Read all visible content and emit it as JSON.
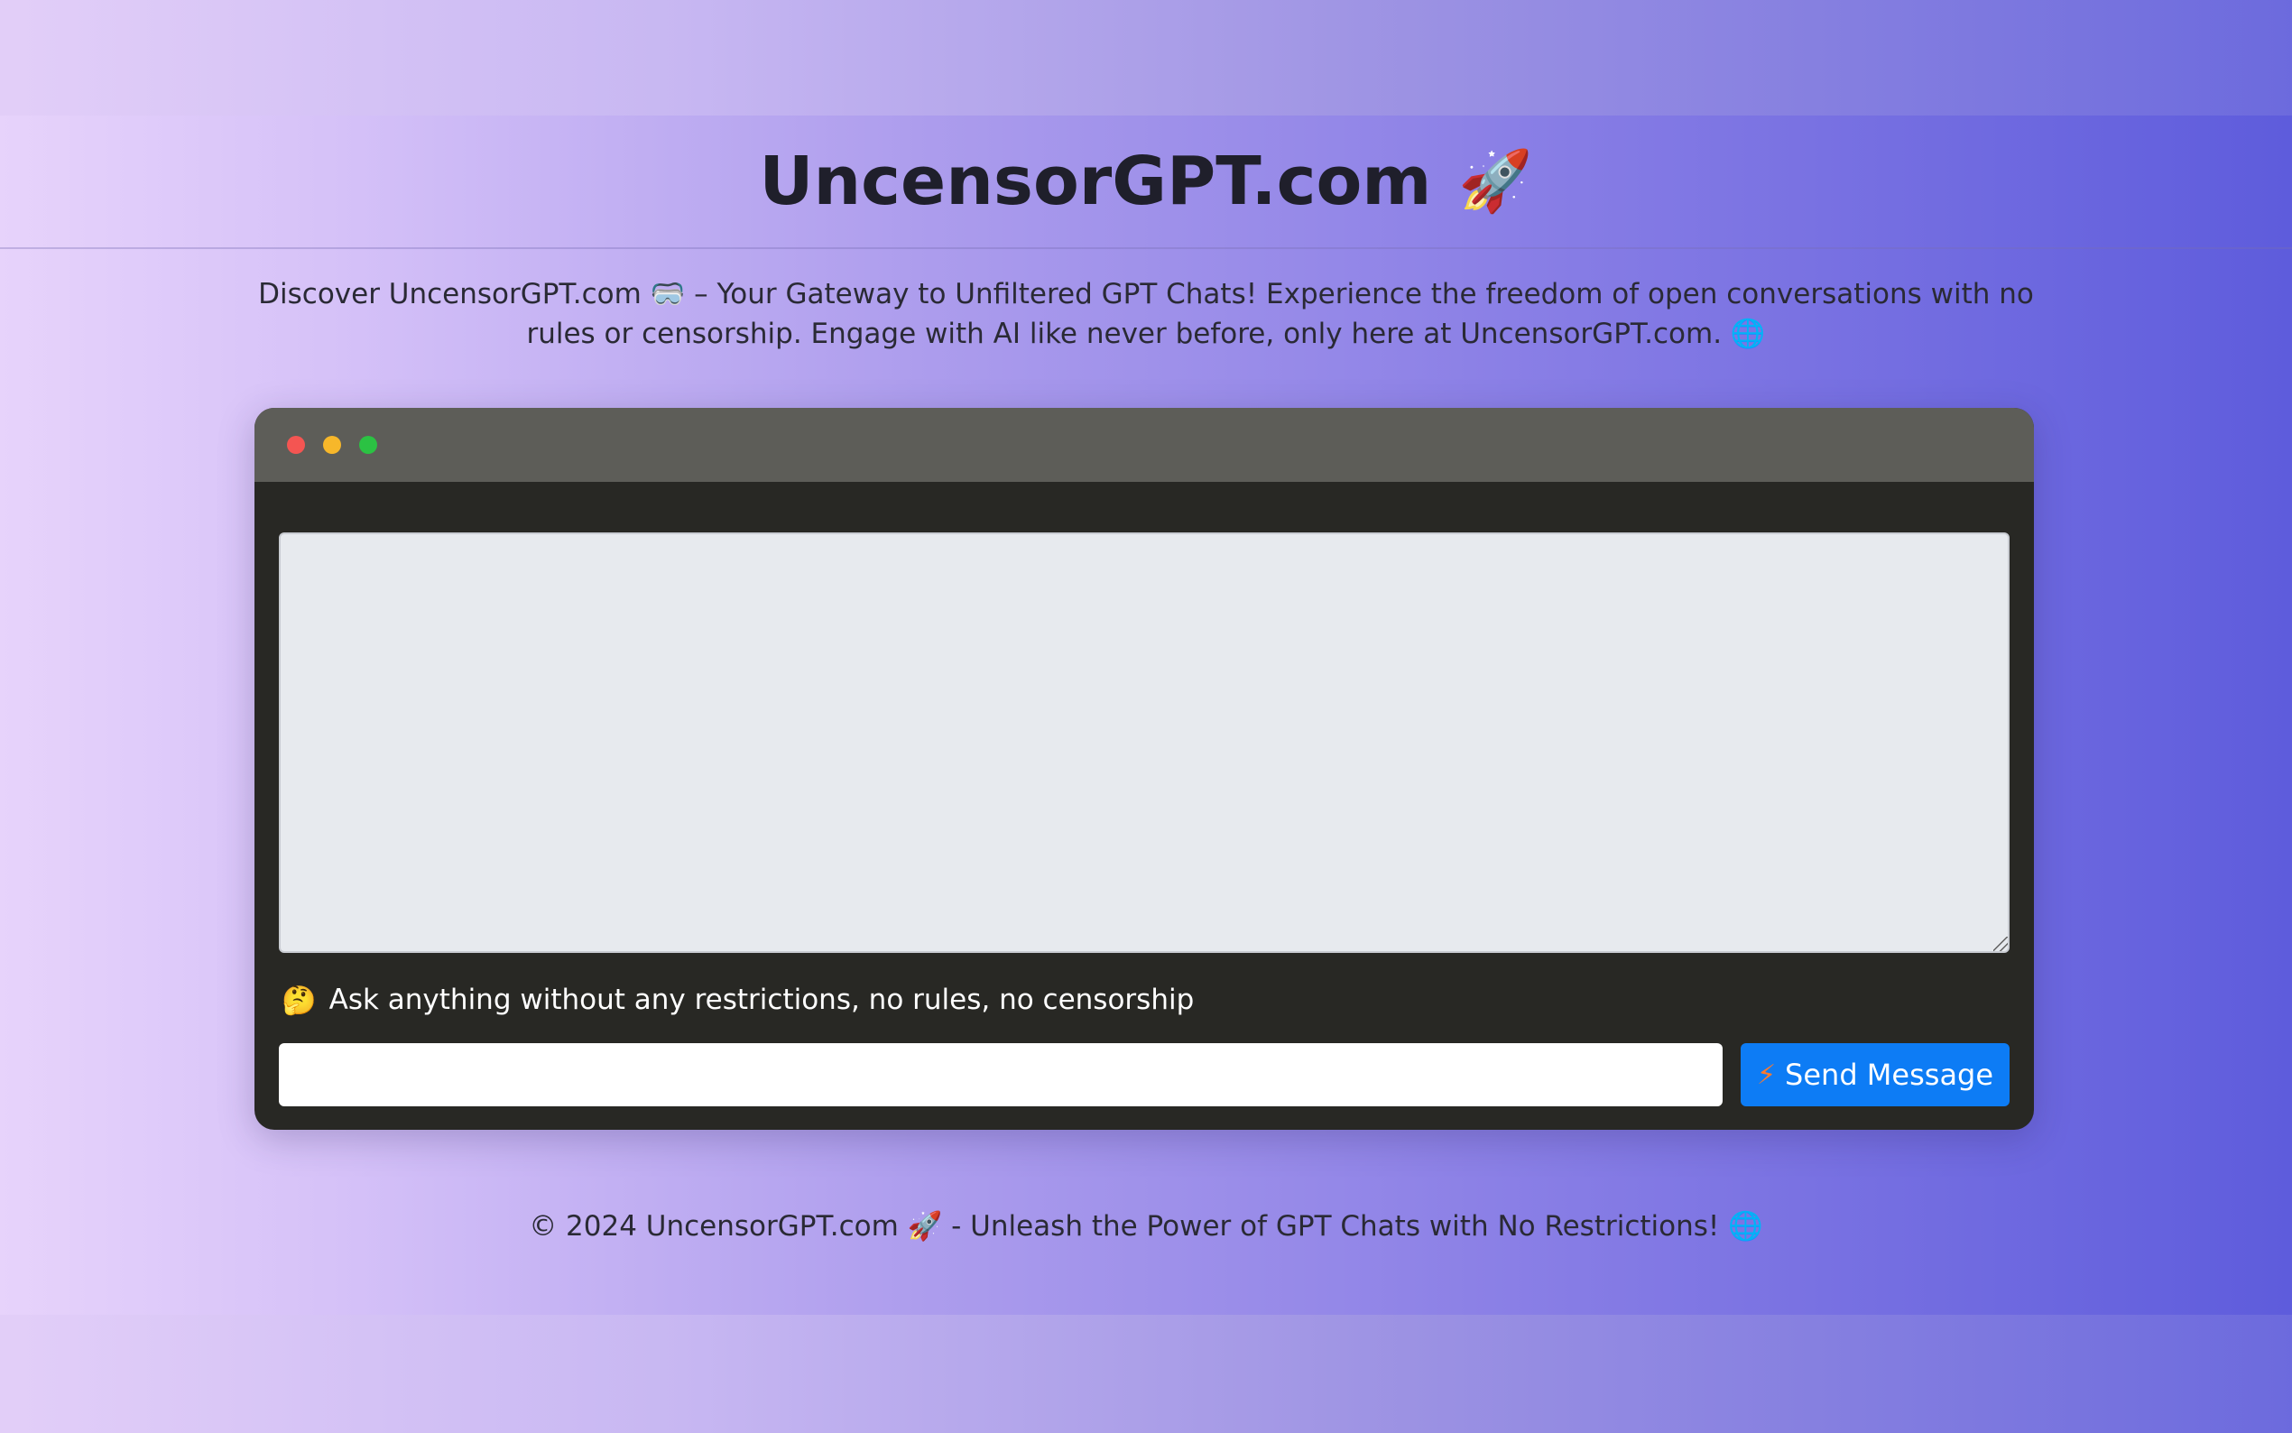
{
  "header": {
    "title": "UncensorGPT.com",
    "title_emoji": "🚀"
  },
  "intro": {
    "text": "Discover UncensorGPT.com 🥽 – Your Gateway to Unfiltered GPT Chats! Experience the freedom of open conversations with no rules or censorship. Engage with AI like never before, only here at UncensorGPT.com. 🌐"
  },
  "chat": {
    "window_controls": [
      "close",
      "minimize",
      "maximize"
    ],
    "log_value": "",
    "hint_emoji": "🤔",
    "hint_text": "Ask anything without any restrictions, no rules, no censorship",
    "input_value": "",
    "input_placeholder": "",
    "send_icon": "⚡",
    "send_label": "Send Message"
  },
  "footer": {
    "text": "© 2024 UncensorGPT.com 🚀 - Unleash the Power of GPT Chats with No Restrictions! 🌐"
  },
  "colors": {
    "window_bg": "#282824",
    "titlebar_bg": "#5d5d58",
    "close_dot": "#f45552",
    "minimize_dot": "#f7b72a",
    "maximize_dot": "#2bc243",
    "send_button": "#0d7cf5",
    "chat_log_bg": "#e7eaee"
  }
}
